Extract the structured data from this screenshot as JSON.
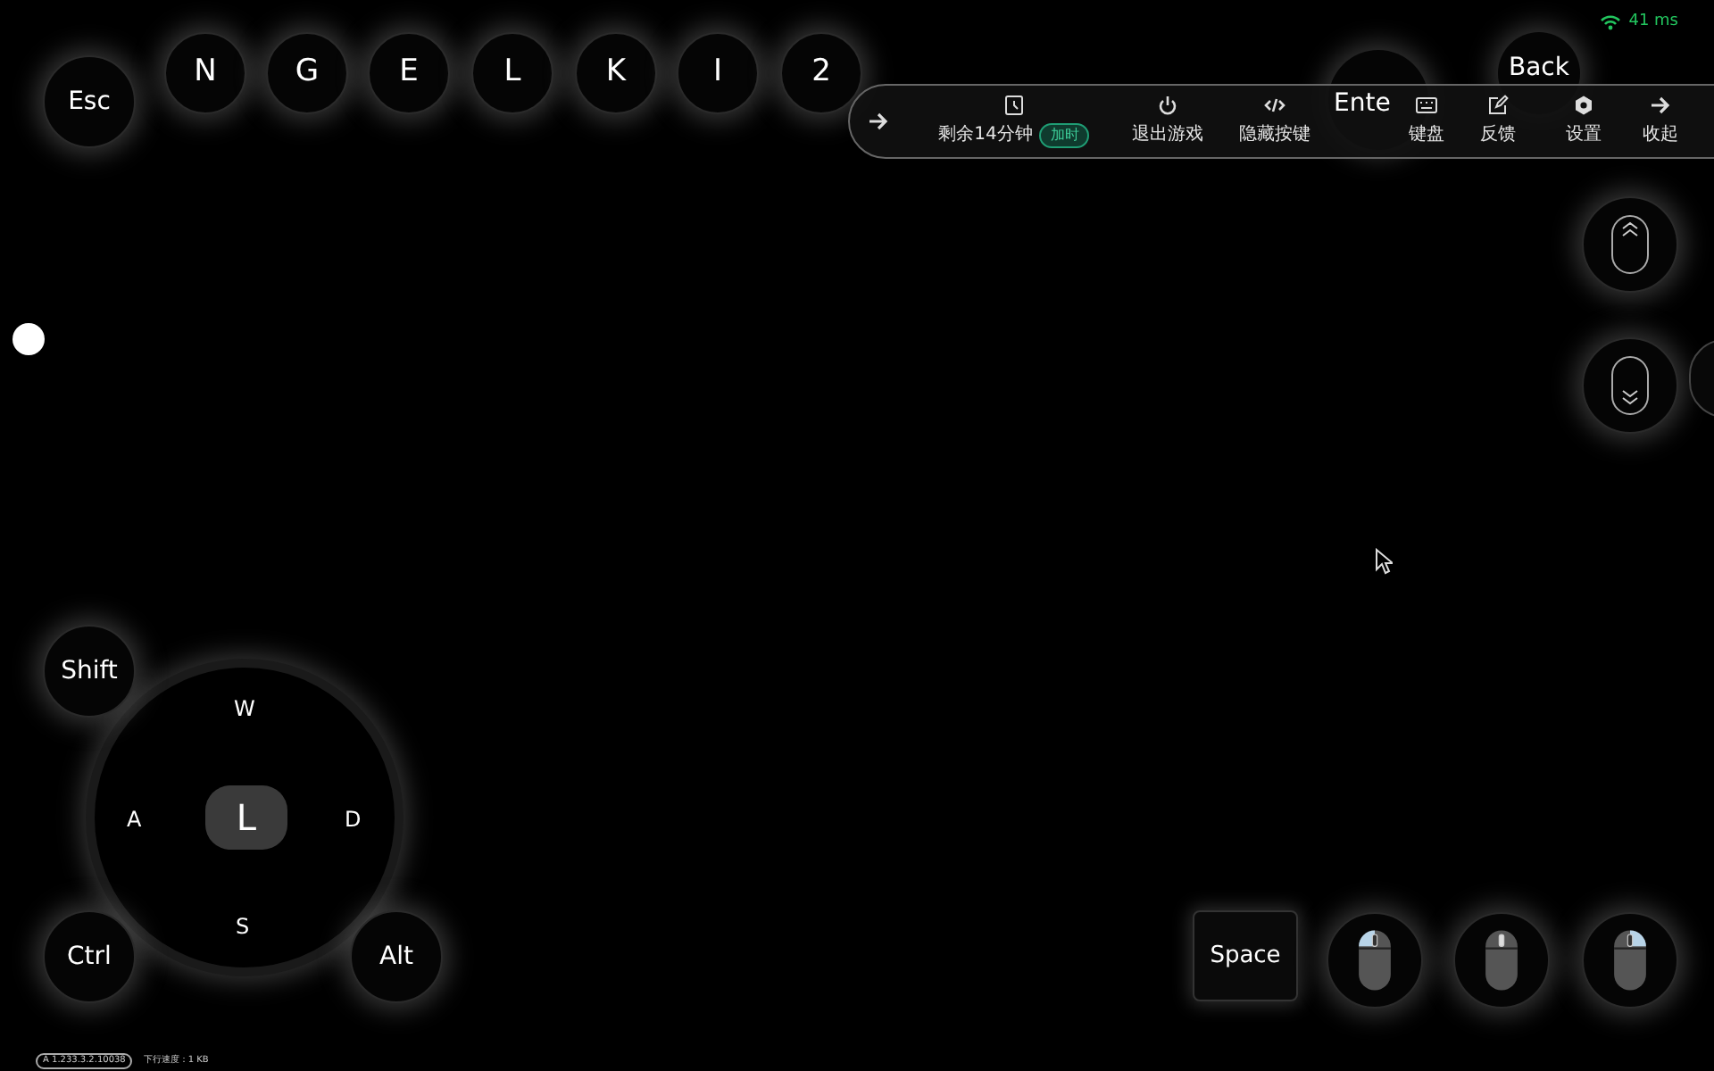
{
  "status": {
    "latency": "41 ms"
  },
  "top_keys": [
    {
      "label": "Esc"
    },
    {
      "label": "N"
    },
    {
      "label": "G"
    },
    {
      "label": "E"
    },
    {
      "label": "L"
    },
    {
      "label": "K"
    },
    {
      "label": "I"
    },
    {
      "label": "2"
    },
    {
      "label": "Ente"
    },
    {
      "label": "Back"
    }
  ],
  "toolbar": {
    "items": [
      {
        "kind": "timer",
        "label": "剩余14分钟",
        "badge": "加时"
      },
      {
        "kind": "power",
        "label": "退出游戏"
      },
      {
        "kind": "code",
        "label": "隐藏按键"
      },
      {
        "kind": "keyboard",
        "label": "键盘"
      },
      {
        "kind": "edit",
        "label": "反馈"
      },
      {
        "kind": "gear",
        "label": "设置"
      },
      {
        "kind": "collapse",
        "label": "收起"
      }
    ]
  },
  "dpad": {
    "center": "L",
    "up": "W",
    "left": "A",
    "right": "D",
    "down": "S"
  },
  "side_keys": [
    {
      "label": "Shift"
    },
    {
      "label": "Ctrl"
    },
    {
      "label": "Alt"
    }
  ],
  "scroll_buttons": [
    {
      "kind": "up"
    },
    {
      "kind": "down"
    }
  ],
  "space_key": {
    "label": "Space"
  },
  "mouse_buttons": [
    {
      "kind": "left"
    },
    {
      "kind": "middle"
    },
    {
      "kind": "right"
    }
  ],
  "footer": {
    "version": "A 1.233.3.2.10038",
    "speed": "下行速度：1 KB"
  }
}
